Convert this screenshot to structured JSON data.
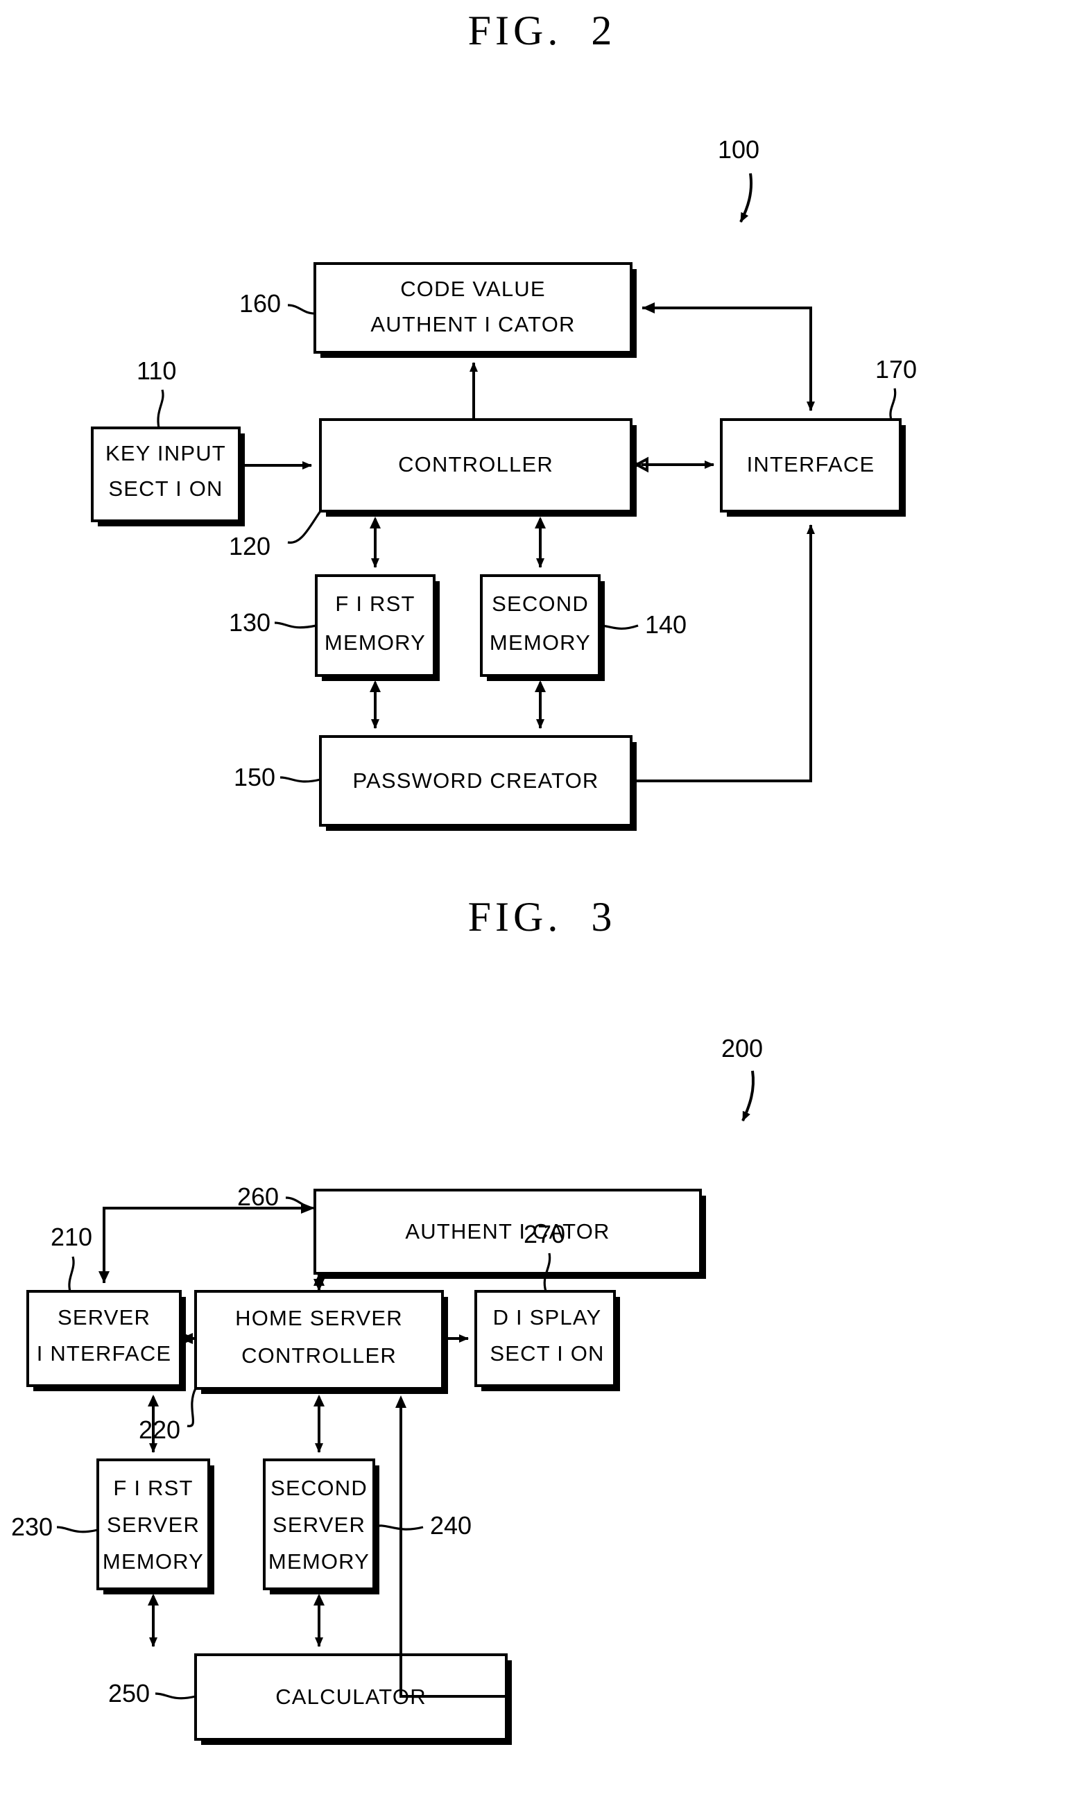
{
  "document": {
    "type": "patent-drawing-sheet",
    "background_color": "#ffffff",
    "ink_color": "#000000"
  },
  "figures": [
    {
      "id": "fig2",
      "title": "FIG.  2",
      "assembly_ref": "100",
      "blocks": [
        {
          "ref": "160",
          "label_lines": [
            "CODE VALUE",
            "AUTHENT I CATOR"
          ],
          "name": "code-value-authenticator"
        },
        {
          "ref": "110",
          "label_lines": [
            "KEY  INPUT",
            "SECT I ON"
          ],
          "name": "key-input-section"
        },
        {
          "ref": "120",
          "label_lines": [
            "CONTROLLER"
          ],
          "name": "controller"
        },
        {
          "ref": "170",
          "label_lines": [
            "INTERFACE"
          ],
          "name": "interface"
        },
        {
          "ref": "130",
          "label_lines": [
            "F I RST",
            "MEMORY"
          ],
          "name": "first-memory"
        },
        {
          "ref": "140",
          "label_lines": [
            "SECOND",
            "MEMORY"
          ],
          "name": "second-memory"
        },
        {
          "ref": "150",
          "label_lines": [
            "PASSWORD  CREATOR"
          ],
          "name": "password-creator"
        }
      ]
    },
    {
      "id": "fig3",
      "title": "FIG.  3",
      "assembly_ref": "200",
      "blocks": [
        {
          "ref": "260",
          "label_lines": [
            "AUTHENT I CATOR"
          ],
          "name": "authenticator"
        },
        {
          "ref": "210",
          "label_lines": [
            "SERVER",
            "I NTERFACE"
          ],
          "name": "server-interface"
        },
        {
          "ref": "220",
          "label_lines": [
            "HOME  SERVER",
            "CONTROLLER"
          ],
          "name": "home-server-controller"
        },
        {
          "ref": "270",
          "label_lines": [
            "D I SPLAY",
            "SECT I ON"
          ],
          "name": "display-section"
        },
        {
          "ref": "230",
          "label_lines": [
            "F I RST",
            "SERVER",
            "MEMORY"
          ],
          "name": "first-server-memory"
        },
        {
          "ref": "240",
          "label_lines": [
            "SECOND",
            "SERVER",
            "MEMORY"
          ],
          "name": "second-server-memory"
        },
        {
          "ref": "250",
          "label_lines": [
            "CALCULATOR"
          ],
          "name": "calculator"
        }
      ]
    }
  ],
  "fig2": {
    "title": "FIG.  2",
    "assembly_ref": "100",
    "code_value_authenticator": {
      "line1": "CODE VALUE",
      "line2": "AUTHENT I CATOR",
      "ref": "160"
    },
    "key_input_section": {
      "line1": "KEY  INPUT",
      "line2": "SECT I ON",
      "ref": "110"
    },
    "controller": {
      "line1": "CONTROLLER",
      "ref": "120"
    },
    "interface": {
      "line1": "INTERFACE",
      "ref": "170"
    },
    "first_memory": {
      "line1": "F I RST",
      "line2": "MEMORY",
      "ref": "130"
    },
    "second_memory": {
      "line1": "SECOND",
      "line2": "MEMORY",
      "ref": "140"
    },
    "password_creator": {
      "line1": "PASSWORD  CREATOR",
      "ref": "150"
    }
  },
  "fig3": {
    "title": "FIG.  3",
    "assembly_ref": "200",
    "authenticator": {
      "line1": "AUTHENT I CATOR",
      "ref": "260"
    },
    "server_interface": {
      "line1": "SERVER",
      "line2": "I NTERFACE",
      "ref": "210"
    },
    "home_server_controller": {
      "line1": "HOME  SERVER",
      "line2": "CONTROLLER",
      "ref": "220"
    },
    "display_section": {
      "line1": "D I SPLAY",
      "line2": "SECT I ON",
      "ref": "270"
    },
    "first_server_memory": {
      "line1": "F I RST",
      "line2": "SERVER",
      "line3": "MEMORY",
      "ref": "230"
    },
    "second_server_memory": {
      "line1": "SECOND",
      "line2": "SERVER",
      "line3": "MEMORY",
      "ref": "240"
    },
    "calculator": {
      "line1": "CALCULATOR",
      "ref": "250"
    }
  }
}
